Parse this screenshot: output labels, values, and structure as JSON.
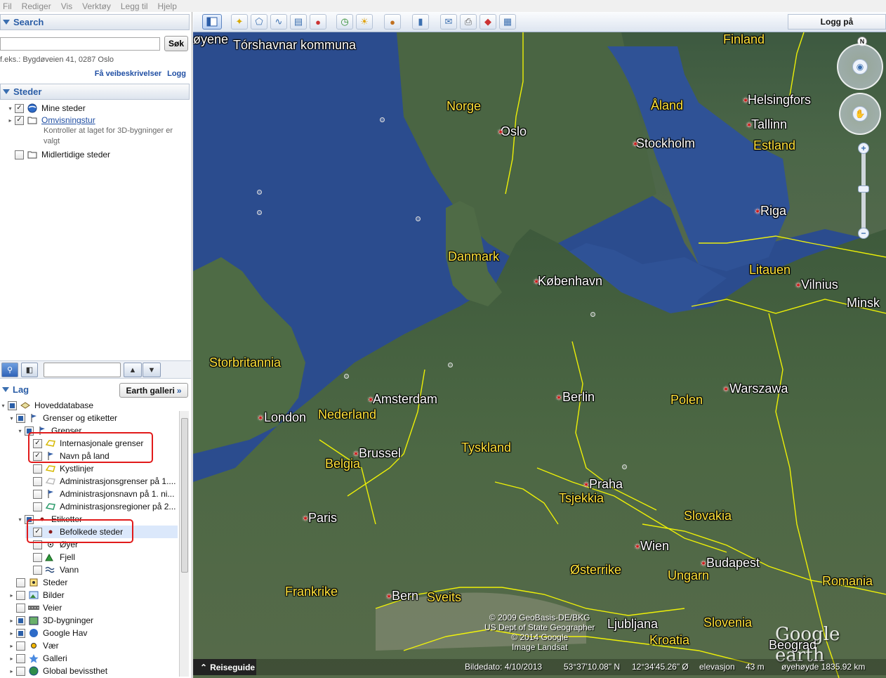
{
  "menu": [
    "Fil",
    "Rediger",
    "Vis",
    "Verktøy",
    "Legg til",
    "Hjelp"
  ],
  "search": {
    "title": "Search",
    "input_value": "",
    "button": "Søk",
    "hint": "f.eks.: Bygdøveien 41, 0287 Oslo",
    "directions": "Få veibeskrivelser",
    "history": "Logg"
  },
  "places": {
    "title": "Steder",
    "items": [
      {
        "label": "Mine steder"
      },
      {
        "label": "Omvisningstur",
        "desc": "Kontroller at laget for 3D-bygninger er valgt"
      },
      {
        "label": "Midlertidige steder"
      }
    ]
  },
  "layers": {
    "title": "Lag",
    "gallery": "Earth galleri",
    "items": [
      {
        "label": "Hoveddatabase"
      },
      {
        "label": "Grenser og etiketter"
      },
      {
        "label": "Grenser"
      },
      {
        "label": "Internasjonale grenser",
        "checked": true
      },
      {
        "label": "Navn på land",
        "checked": true
      },
      {
        "label": "Kystlinjer"
      },
      {
        "label": "Administrasjonsgrenser på 1...."
      },
      {
        "label": "Administrasjonsnavn på 1. ni..."
      },
      {
        "label": "Administrasjonsregioner på 2..."
      },
      {
        "label": "Etiketter"
      },
      {
        "label": "Befolkede steder",
        "checked": true
      },
      {
        "label": "Øyer"
      },
      {
        "label": "Fjell"
      },
      {
        "label": "Vann"
      },
      {
        "label": "Steder"
      },
      {
        "label": "Bilder"
      },
      {
        "label": "Veier"
      },
      {
        "label": "3D-bygninger"
      },
      {
        "label": "Google Hav"
      },
      {
        "label": "Vær"
      },
      {
        "label": "Galleri"
      },
      {
        "label": "Global bevissthet"
      }
    ]
  },
  "toolbar": {
    "login": "Logg på"
  },
  "map": {
    "countries": [
      "Finland",
      "Norge",
      "Åland",
      "Estland",
      "Danmark",
      "Litauen",
      "Storbritannia",
      "Polen",
      "Nederland",
      "Tyskland",
      "Belgia",
      "Tsjekkia",
      "Slovakia",
      "Østerrike",
      "Ungarn",
      "Frankrike",
      "Sveits",
      "Romania",
      "Slovenia",
      "Kroatia"
    ],
    "cities": [
      "øyene",
      "Tórshavnar kommuna",
      "Helsingfors",
      "Oslo",
      "Stockholm",
      "Tallinn",
      "Riga",
      "København",
      "Vilnius",
      "Minsk",
      "Warszawa",
      "Berlin",
      "Amsterdam",
      "London",
      "Brussel",
      "Praha",
      "Paris",
      "Wien",
      "Budapest",
      "Bern",
      "Ljubljana",
      "Beograd"
    ],
    "copyright": [
      "© 2009 GeoBasis-DE/BKG",
      "US Dept of State Geographer",
      "© 2014 Google",
      "Image Landsat"
    ],
    "brand": "Google earth"
  },
  "status": {
    "guide": "Reiseguide",
    "date": "Bildedato: 4/10/2013",
    "lat": "53°37'10.08\" N",
    "lon": "12°34'45.26\" Ø",
    "elevation": "elevasjon",
    "elev_val": "43 m",
    "eye": "øyehøyde 1835.92 km"
  },
  "colors": {
    "country_label": "#ffe23a",
    "city_label": "#ffffff",
    "border": "#ffff00",
    "highlight": "#e11b1b",
    "accent": "#2a5da6"
  }
}
